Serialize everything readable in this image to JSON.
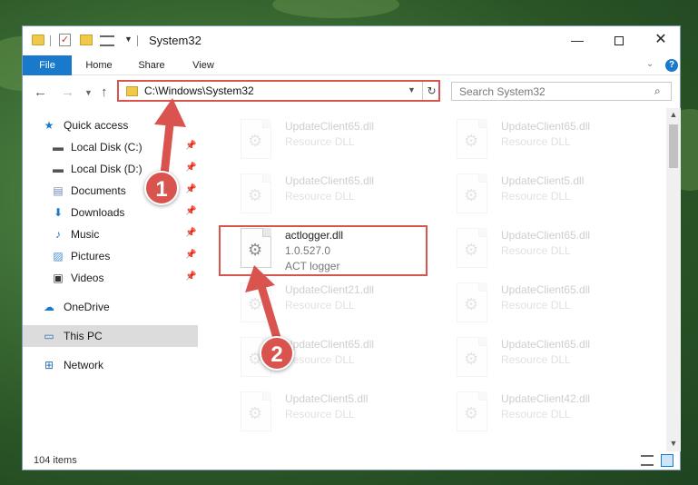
{
  "window": {
    "title": "System32"
  },
  "ribbon": {
    "tabs": [
      {
        "label": "File"
      },
      {
        "label": "Home"
      },
      {
        "label": "Share"
      },
      {
        "label": "View"
      }
    ]
  },
  "address": {
    "path": "C:\\Windows\\System32",
    "search_placeholder": "Search System32"
  },
  "sidebar": {
    "items": [
      {
        "label": "Quick access",
        "icon": "star-icon"
      },
      {
        "label": "Local Disk (C:)",
        "icon": "drive-icon"
      },
      {
        "label": "Local Disk (D:)",
        "icon": "drive-icon"
      },
      {
        "label": "Documents",
        "icon": "documents-icon"
      },
      {
        "label": "Downloads",
        "icon": "download-icon"
      },
      {
        "label": "Music",
        "icon": "music-icon"
      },
      {
        "label": "Pictures",
        "icon": "pictures-icon"
      },
      {
        "label": "Videos",
        "icon": "videos-icon"
      },
      {
        "label": "OneDrive",
        "icon": "cloud-icon"
      },
      {
        "label": "This PC",
        "icon": "computer-icon"
      },
      {
        "label": "Network",
        "icon": "network-icon"
      }
    ]
  },
  "files": [
    {
      "name": "UpdateClient65.dll",
      "desc": "Resource DLL"
    },
    {
      "name": "UpdateClient65.dll",
      "desc": "Resource DLL"
    },
    {
      "name": "UpdateClient65.dll",
      "desc": "Resource DLL"
    },
    {
      "name": "UpdateClient5.dll",
      "desc": "Resource DLL"
    },
    {
      "name": "actlogger.dll",
      "version": "1.0.527.0",
      "desc": "ACT logger"
    },
    {
      "name": "UpdateClient65.dll",
      "desc": "Resource DLL"
    },
    {
      "name": "UpdateClient21.dll",
      "desc": "Resource DLL"
    },
    {
      "name": "UpdateClient65.dll",
      "desc": "Resource DLL"
    },
    {
      "name": "UpdateClient65.dll",
      "desc": "Resource DLL"
    },
    {
      "name": "UpdateClient65.dll",
      "desc": "Resource DLL"
    },
    {
      "name": "UpdateClient5.dll",
      "desc": "Resource DLL"
    },
    {
      "name": "UpdateClient42.dll",
      "desc": "Resource DLL"
    }
  ],
  "status": {
    "item_count": "104 items"
  },
  "callouts": {
    "one": "1",
    "two": "2"
  },
  "colors": {
    "accent": "#1979ca",
    "highlight": "#d9534f"
  }
}
